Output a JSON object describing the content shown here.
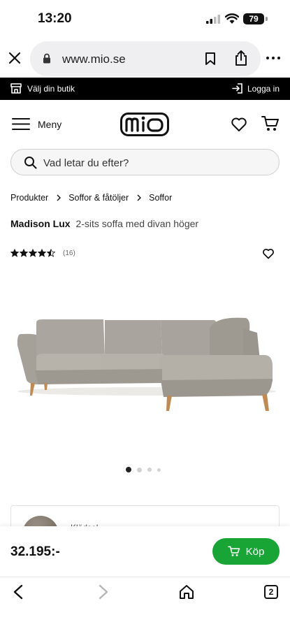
{
  "status": {
    "time": "13:20",
    "battery": "79"
  },
  "browser": {
    "url": "www.mio.se",
    "tab_count": "2"
  },
  "topbar": {
    "store_label": "Välj din butik",
    "login_label": "Logga in"
  },
  "header": {
    "menu_label": "Meny",
    "logo_text": "mio"
  },
  "search": {
    "placeholder": "Vad letar du efter?"
  },
  "breadcrumbs": [
    "Produkter",
    "Soffor & fåtöljer",
    "Soffor"
  ],
  "product": {
    "brand": "Madison Lux",
    "description": "2-sits soffa med divan höger",
    "rating": 4.5,
    "rating_max": 5,
    "review_count": "(16)",
    "image_index": 1,
    "image_total": 4,
    "option_label": "Klädsel",
    "price": "32.195:-",
    "buy_label": "Köp"
  },
  "colors": {
    "buy": "#18a536",
    "topbar": "#000000",
    "sofa": "#a8a49d"
  }
}
